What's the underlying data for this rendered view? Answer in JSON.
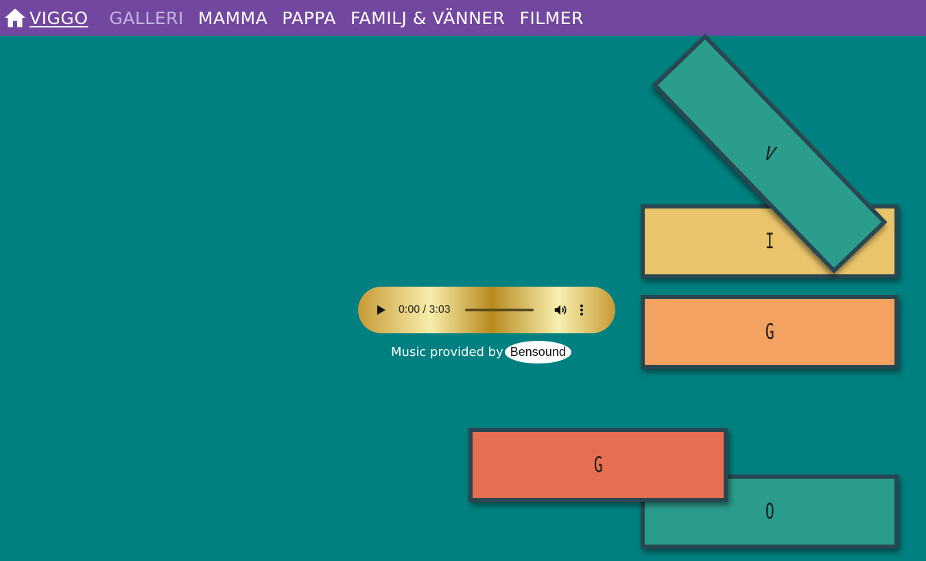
{
  "nav": {
    "home_icon": "home-icon",
    "brand": "VIGGO",
    "items": [
      "GALLERI",
      "MAMMA",
      "PAPPA",
      "FAMILJ & VÄNNER",
      "FILMER"
    ],
    "active_item": "GALLERI"
  },
  "blocks": {
    "v": "V",
    "i": "I",
    "g1": "G",
    "g2": "G",
    "o": "O"
  },
  "audio": {
    "time": "0:00 / 3:03",
    "progress": 0
  },
  "credit": {
    "text": "Music provided by",
    "link": "Bensound"
  },
  "colors": {
    "background": "#008080",
    "navbar": "#7247a0",
    "teal_block": "#2a9d8c",
    "yellow_block": "#e9c46a",
    "orange_block": "#f4a261",
    "red_block": "#e76f51",
    "block_border": "#2a4751"
  }
}
